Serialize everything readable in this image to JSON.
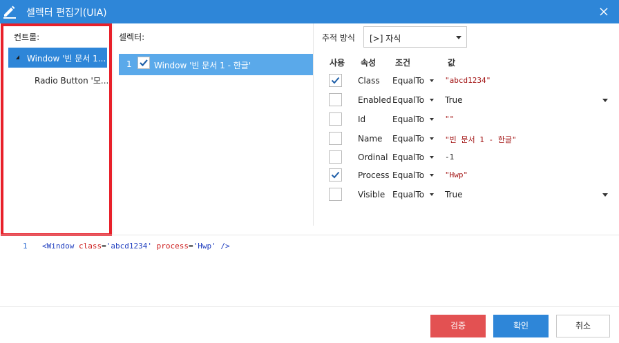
{
  "window": {
    "title": "셀렉터 편집기(UIA)",
    "icons": {
      "edit": "pencil-icon",
      "close": "close-icon"
    },
    "accent_color": "#2e86d8"
  },
  "controls_panel": {
    "header": "컨트롤:",
    "items": [
      {
        "label": "Window '빈 문서 1...",
        "selected": true,
        "expanded": true
      },
      {
        "label": "Radio Button '모...",
        "selected": false
      }
    ]
  },
  "selector_panel": {
    "header": "셀렉터:",
    "items": [
      {
        "index": "1",
        "checked": true,
        "label": "Window '빈 문서 1 - 한글'"
      }
    ]
  },
  "trace": {
    "label": "추적 방식",
    "selected": "[>] 자식"
  },
  "properties": {
    "columns": [
      "사용",
      "속성",
      "조건",
      "값"
    ],
    "rows": [
      {
        "use": true,
        "name": "Class",
        "condition": "EqualTo",
        "value": "\"abcd1234\"",
        "has_value_dropdown": false
      },
      {
        "use": false,
        "name": "Enabled",
        "condition": "EqualTo",
        "value": "True",
        "has_value_dropdown": true
      },
      {
        "use": false,
        "name": "Id",
        "condition": "EqualTo",
        "value": "\"\"",
        "has_value_dropdown": false
      },
      {
        "use": false,
        "name": "Name",
        "condition": "EqualTo",
        "value": "\"빈 문서 1 - 한글\"",
        "has_value_dropdown": false
      },
      {
        "use": false,
        "name": "Ordinal",
        "condition": "EqualTo",
        "value": "-1",
        "has_value_dropdown": false
      },
      {
        "use": true,
        "name": "Process",
        "condition": "EqualTo",
        "value": "\"Hwp\"",
        "has_value_dropdown": false
      },
      {
        "use": false,
        "name": "Visible",
        "condition": "EqualTo",
        "value": "True",
        "has_value_dropdown": true
      }
    ]
  },
  "code_preview": {
    "line_number": "1",
    "tag_open": "<Window",
    "attr1": "class",
    "val1": "'abcd1234'",
    "attr2": "process",
    "val2": "'Hwp'",
    "tag_close": "/>"
  },
  "buttons": {
    "verify": "검증",
    "ok": "확인",
    "cancel": "취소"
  },
  "colors": {
    "highlight_frame": "#e8202a",
    "verify_button": "#e35152",
    "ok_button": "#2e86d8",
    "selector_row": "#5aa9ea"
  }
}
